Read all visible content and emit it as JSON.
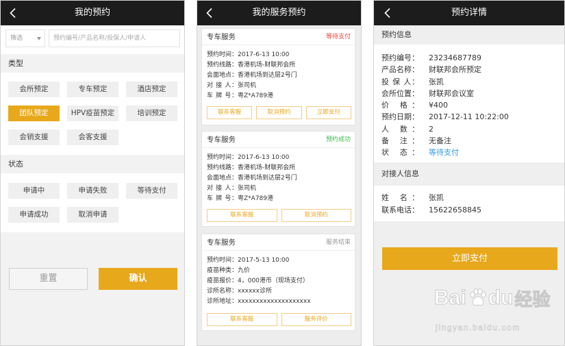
{
  "colors": {
    "accent": "#e8a81c",
    "header_bg": "#1c1c1c",
    "status_pending": "#f04a3a",
    "status_success": "#3dbb4b",
    "status_ended": "#999999",
    "status_link": "#2f9bf0"
  },
  "screen1": {
    "title": "我的预约",
    "back_icon": "chevron-left-icon",
    "filter": {
      "select_value": "筛选",
      "select_icon": "triangle-down-icon",
      "search_placeholder": "预约编号/产品名称/投保人/申请人"
    },
    "type_section": {
      "label": "类型",
      "options": [
        "会所预定",
        "专车预定",
        "酒店预定",
        "团队预定",
        "HPV疫苗预定",
        "培训预定",
        "会销支援",
        "会客支援"
      ],
      "selected_index": 3
    },
    "status_section": {
      "label": "状态",
      "options": [
        "申请中",
        "申请失败",
        "等待支付",
        "申请成功",
        "取消申请"
      ]
    },
    "reset_label": "重置",
    "confirm_label": "确认"
  },
  "screen2": {
    "title": "我的服务预约",
    "back_icon": "chevron-left-icon",
    "cards": [
      {
        "title": "专车服务",
        "status": "等待支付",
        "status_color": "#f04a3a",
        "rows": [
          {
            "label": "预约时间：",
            "value": "2017-6-13 10:00"
          },
          {
            "label": "预约线路：",
            "value": "香港机场-财联邦会所"
          },
          {
            "label": "会面地点：",
            "value": "香港机场到达层2号门"
          },
          {
            "label": "对 接 人：",
            "value": "张司机"
          },
          {
            "label": "车 牌 号：",
            "value": "粤Z*A789港"
          }
        ],
        "buttons": [
          "联系客服",
          "取消预约",
          "立即支付"
        ]
      },
      {
        "title": "专车服务",
        "status": "预约成功",
        "status_color": "#3dbb4b",
        "rows": [
          {
            "label": "预约时间：",
            "value": "2017-6-13 10:00"
          },
          {
            "label": "预约线路：",
            "value": "香港机场-财联邦会所"
          },
          {
            "label": "会面地点：",
            "value": "香港机场到达层2号门"
          },
          {
            "label": "对 接 人：",
            "value": "张司机"
          },
          {
            "label": "车 牌 号：",
            "value": "粤Z*A789港"
          }
        ],
        "buttons": [
          "联系客服",
          "取消预约"
        ]
      },
      {
        "title": "专车服务",
        "status": "服务结束",
        "status_color": "#999999",
        "rows": [
          {
            "label": "预约时间：",
            "value": "2017-5-13 10:00"
          },
          {
            "label": "疫苗种类：",
            "value": "九价"
          },
          {
            "label": "疫苗报价：",
            "value": "4，000港币（现场支付）"
          },
          {
            "label": "诊所名称：",
            "value": "xxxxxx诊所"
          },
          {
            "label": "诊所地址：",
            "value": "xxxxxxxxxxxxxxxxxxxx"
          }
        ],
        "buttons": [
          "联系客服",
          "服务评价"
        ]
      }
    ]
  },
  "screen3": {
    "title": "预约详情",
    "back_icon": "chevron-left-icon",
    "booking_section": {
      "label": "预约信息",
      "rows": [
        {
          "label": "预约编号：",
          "value": "23234687789"
        },
        {
          "label": "产品名称：",
          "value": "财联邦会所预定"
        },
        {
          "label": "投 保 人：",
          "value": "张凯"
        },
        {
          "label": "会所位置：",
          "value": "财联邦会议室"
        },
        {
          "label": "价 格：",
          "value": "¥400"
        },
        {
          "label": "预约日期：",
          "value": "2017-12-11 10:22:00"
        },
        {
          "label": "人 数：",
          "value": "2"
        },
        {
          "label": "备 注：",
          "value": "无备注"
        },
        {
          "label": "状 态：",
          "value": "等待支付",
          "value_color": "#2f9bf0"
        }
      ]
    },
    "contact_section": {
      "label": "对接人信息",
      "rows": [
        {
          "label": "姓 名：",
          "value": "张凯"
        },
        {
          "label": "联系电话：",
          "value": "15622658845"
        }
      ]
    },
    "pay_label": "立即支付"
  },
  "watermark": {
    "brand_left": "Bai",
    "brand_icon": "paw-icon",
    "brand_right": "du",
    "brand_cn": "经验",
    "url": "jingyan.baidu.com"
  }
}
